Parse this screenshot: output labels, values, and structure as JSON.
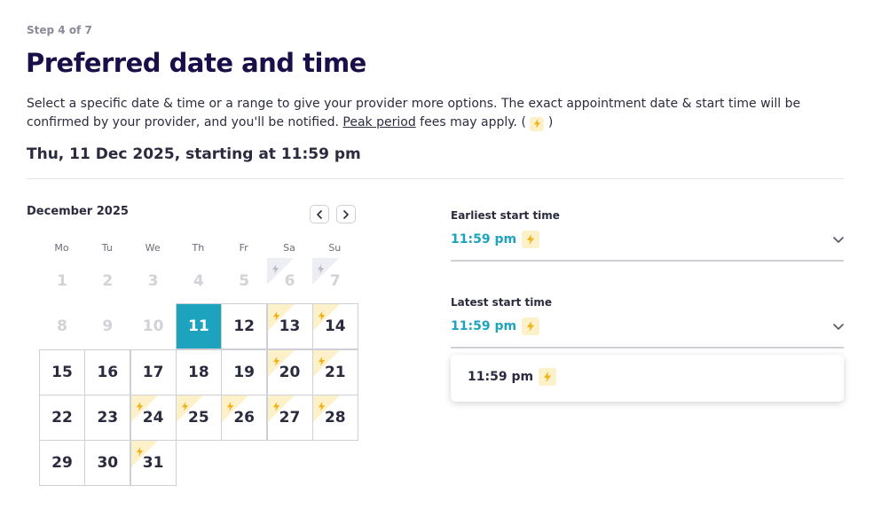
{
  "step": "Step 4 of 7",
  "title": "Preferred date and time",
  "description": {
    "part1": "Select a specific date & time or a range to give your provider more options. The exact appointment date & start time will be confirmed by your provider, and you'll be notified. ",
    "link": "Peak period",
    "part2": " fees may apply. (",
    "part3": " )"
  },
  "summary": "Thu, 11 Dec 2025, starting at 11:59 pm",
  "calendar": {
    "month": "December 2025",
    "weekdays": [
      "Mo",
      "Tu",
      "We",
      "Th",
      "Fr",
      "Sa",
      "Su"
    ],
    "weeks": [
      [
        {
          "day": "1",
          "state": "disabled",
          "peak": false
        },
        {
          "day": "2",
          "state": "disabled",
          "peak": false
        },
        {
          "day": "3",
          "state": "disabled",
          "peak": false
        },
        {
          "day": "4",
          "state": "disabled",
          "peak": false
        },
        {
          "day": "5",
          "state": "disabled",
          "peak": false
        },
        {
          "day": "6",
          "state": "disabled",
          "peak": true
        },
        {
          "day": "7",
          "state": "disabled",
          "peak": true
        }
      ],
      [
        {
          "day": "8",
          "state": "disabled",
          "peak": false
        },
        {
          "day": "9",
          "state": "disabled",
          "peak": false
        },
        {
          "day": "10",
          "state": "disabled",
          "peak": false
        },
        {
          "day": "11",
          "state": "selected",
          "peak": false
        },
        {
          "day": "12",
          "state": "available",
          "peak": false
        },
        {
          "day": "13",
          "state": "available",
          "peak": true
        },
        {
          "day": "14",
          "state": "available",
          "peak": true
        }
      ],
      [
        {
          "day": "15",
          "state": "available",
          "peak": false
        },
        {
          "day": "16",
          "state": "available",
          "peak": false
        },
        {
          "day": "17",
          "state": "available",
          "peak": false
        },
        {
          "day": "18",
          "state": "available",
          "peak": false
        },
        {
          "day": "19",
          "state": "available",
          "peak": false
        },
        {
          "day": "20",
          "state": "available",
          "peak": true
        },
        {
          "day": "21",
          "state": "available",
          "peak": true
        }
      ],
      [
        {
          "day": "22",
          "state": "available",
          "peak": false
        },
        {
          "day": "23",
          "state": "available",
          "peak": false
        },
        {
          "day": "24",
          "state": "available",
          "peak": true
        },
        {
          "day": "25",
          "state": "available",
          "peak": true
        },
        {
          "day": "26",
          "state": "available",
          "peak": true
        },
        {
          "day": "27",
          "state": "available",
          "peak": true
        },
        {
          "day": "28",
          "state": "available",
          "peak": true
        }
      ],
      [
        {
          "day": "29",
          "state": "available",
          "peak": false
        },
        {
          "day": "30",
          "state": "available",
          "peak": false
        },
        {
          "day": "31",
          "state": "available",
          "peak": true
        }
      ]
    ]
  },
  "earliest": {
    "label": "Earliest start time",
    "value": "11:59 pm",
    "peak": true
  },
  "latest": {
    "label": "Latest start time",
    "value": "11:59 pm",
    "peak": true
  },
  "dropdown_options": [
    {
      "label": "11:59 pm",
      "peak": true
    }
  ],
  "colors": {
    "accent": "#1ea3be",
    "peak_bg": "#fdf1c9",
    "peak_bolt": "#f3b21a",
    "title": "#1b0f4a"
  }
}
